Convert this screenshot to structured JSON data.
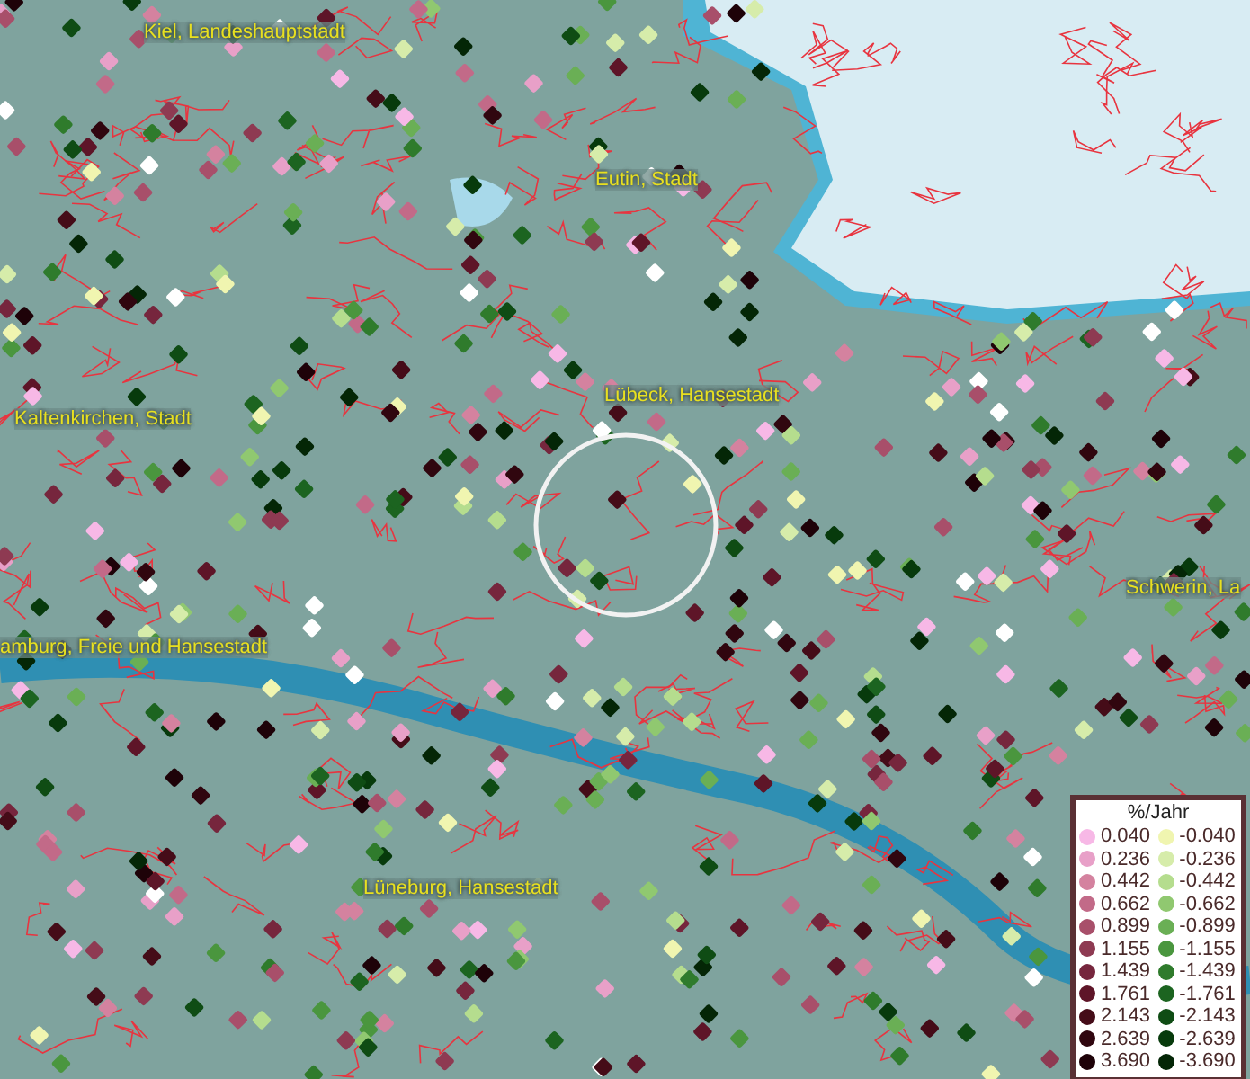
{
  "map": {
    "place_labels": [
      "Kiel, Landeshauptstadt",
      "Eutin, Stadt",
      "Lübeck, Hansestadt",
      "Kaltenkirchen, Stadt",
      "Schwerin, La",
      "amburg, Freie und Hansestadt",
      "Lüneburg, Hansestadt"
    ]
  },
  "legend": {
    "title": "%/Jahr",
    "positive": [
      {
        "label": "0.040",
        "color": "#f7b8e6"
      },
      {
        "label": "0.236",
        "color": "#e8a0c8"
      },
      {
        "label": "0.442",
        "color": "#d4829f"
      },
      {
        "label": "0.662",
        "color": "#c26a88"
      },
      {
        "label": "0.899",
        "color": "#a84f6a"
      },
      {
        "label": "1.155",
        "color": "#8e3a52"
      },
      {
        "label": "1.439",
        "color": "#76263d"
      },
      {
        "label": "1.761",
        "color": "#5e1528"
      },
      {
        "label": "2.143",
        "color": "#450c18"
      },
      {
        "label": "2.639",
        "color": "#30060f"
      },
      {
        "label": "3.690",
        "color": "#1e0208"
      }
    ],
    "negative": [
      {
        "label": "-0.040",
        "color": "#f0f5b0"
      },
      {
        "label": "-0.236",
        "color": "#d6ecaa"
      },
      {
        "label": "-0.442",
        "color": "#b5dd8e"
      },
      {
        "label": "-0.662",
        "color": "#90c870"
      },
      {
        "label": "-0.899",
        "color": "#6aaf55"
      },
      {
        "label": "-1.155",
        "color": "#4a963e"
      },
      {
        "label": "-1.439",
        "color": "#2f7b2c"
      },
      {
        "label": "-1.761",
        "color": "#1c6420"
      },
      {
        "label": "-2.143",
        "color": "#0f4c14"
      },
      {
        "label": "-2.639",
        "color": "#073a0c"
      },
      {
        "label": "-3.690",
        "color": "#042606"
      }
    ]
  }
}
